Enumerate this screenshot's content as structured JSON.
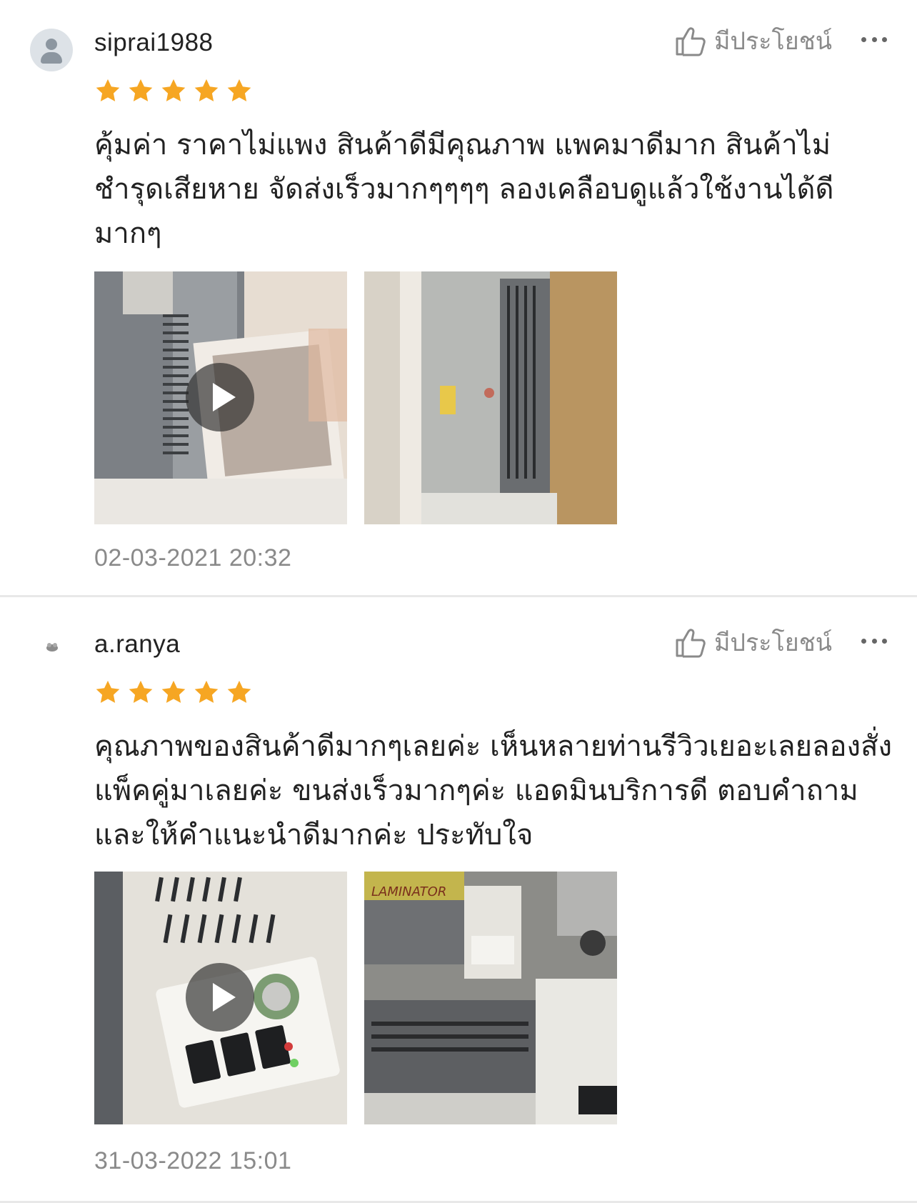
{
  "reviews": [
    {
      "username": "siprai1988",
      "rating": 5,
      "helpful_label": "มีประโยชน์",
      "text": "คุ้มค่า ราคาไม่แพง สินค้าดีมีคุณภาพ แพคมาดีมาก สินค้าไม่ชำรุดเสียหาย จัดส่งเร็วมากๆๆๆๆ ลองเคลือบดูแล้วใช้งานได้ดีมากๆ",
      "media": [
        {
          "kind": "video",
          "icon": "play-icon"
        },
        {
          "kind": "photo"
        }
      ],
      "timestamp": "02-03-2021 20:32"
    },
    {
      "username": "a.ranya",
      "rating": 5,
      "helpful_label": "มีประโยชน์",
      "text": "คุณภาพของสินค้าดีมากๆเลยค่ะ เห็นหลายท่านรีวิวเยอะเลยลองสั่งแพ็คคู่มาเลยค่ะ ขนส่งเร็วมากๆค่ะ แอดมินบริการดี ตอบคำถามและให้คำแนะนำดีมากค่ะ ประทับใจ",
      "media": [
        {
          "kind": "video",
          "icon": "play-icon"
        },
        {
          "kind": "photo",
          "visible_text": "LAMINATOR"
        }
      ],
      "timestamp": "31-03-2022 15:01"
    }
  ],
  "colors": {
    "star": "#F6A623",
    "muted_text": "#8A8A8A",
    "divider": "#E8E8E8"
  }
}
